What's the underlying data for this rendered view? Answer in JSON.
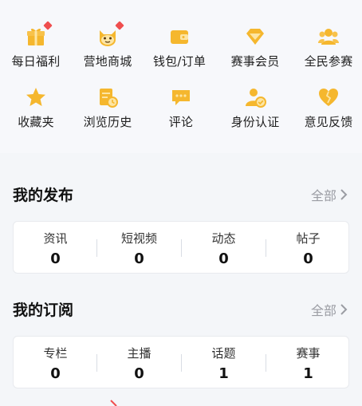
{
  "shortcuts": [
    {
      "label": "每日福利",
      "icon": "gift-icon",
      "badge": true
    },
    {
      "label": "营地商城",
      "icon": "mascot-shop-icon",
      "badge": true
    },
    {
      "label": "钱包/订单",
      "icon": "wallet-icon",
      "badge": false
    },
    {
      "label": "赛事会员",
      "icon": "diamond-icon",
      "badge": false
    },
    {
      "label": "全民参赛",
      "icon": "group-icon",
      "badge": false
    },
    {
      "label": "收藏夹",
      "icon": "star-icon",
      "badge": false
    },
    {
      "label": "浏览历史",
      "icon": "history-icon",
      "badge": false
    },
    {
      "label": "评论",
      "icon": "comment-icon",
      "badge": false
    },
    {
      "label": "身份认证",
      "icon": "verified-user-icon",
      "badge": false
    },
    {
      "label": "意见反馈",
      "icon": "broken-heart-icon",
      "badge": false
    }
  ],
  "my_posts": {
    "title": "我的发布",
    "see_all": "全部",
    "stats": [
      {
        "label": "资讯",
        "value": "0"
      },
      {
        "label": "短视频",
        "value": "0"
      },
      {
        "label": "动态",
        "value": "0"
      },
      {
        "label": "帖子",
        "value": "0"
      }
    ]
  },
  "my_subscriptions": {
    "title": "我的订阅",
    "see_all": "全部",
    "stats": [
      {
        "label": "专栏",
        "value": "0"
      },
      {
        "label": "主播",
        "value": "0"
      },
      {
        "label": "话题",
        "value": "1"
      },
      {
        "label": "赛事",
        "value": "1"
      }
    ]
  },
  "colors": {
    "icon": "#f5b72e",
    "badge": "#ef4e4e",
    "muted": "#9a9ca3"
  }
}
